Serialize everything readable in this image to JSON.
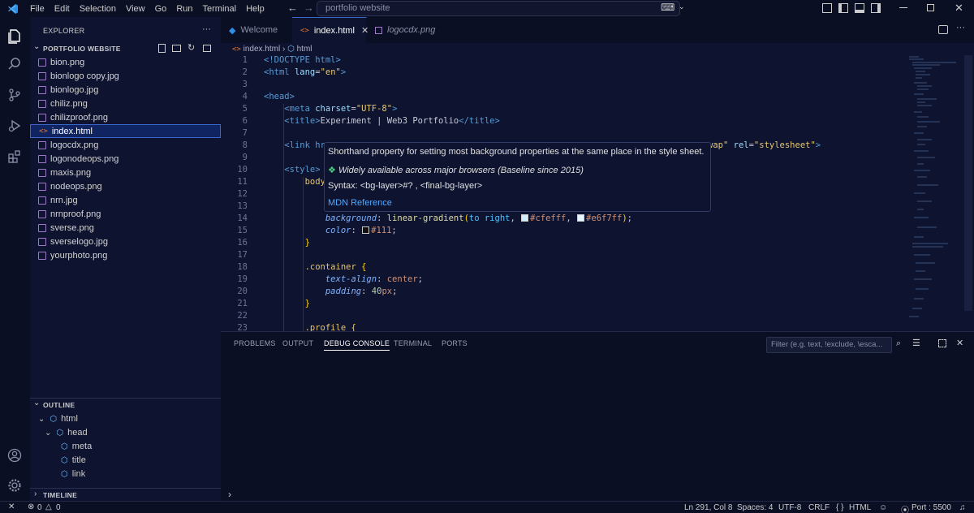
{
  "menu": [
    "File",
    "Edit",
    "Selection",
    "View",
    "Go",
    "Run",
    "Terminal",
    "Help"
  ],
  "search": {
    "placeholder": "portfolio website"
  },
  "sidebar": {
    "title": "EXPLORER",
    "more": "···",
    "folder": "PORTFOLIO WEBSITE",
    "files": [
      "bion.png",
      "bionlogo copy.jpg",
      "bionlogo.jpg",
      "chiliz.png",
      "chilizproof.png",
      "index.html",
      "logocdx.png",
      "logonodeops.png",
      "maxis.png",
      "nodeops.png",
      "nrn.jpg",
      "nrnproof.png",
      "sverse.png",
      "sverselogo.jpg",
      "yourphoto.png"
    ],
    "selected_index": 5,
    "outline": {
      "title": "OUTLINE",
      "items": [
        "html",
        "head",
        "meta",
        "title",
        "link"
      ]
    },
    "timeline": "TIMELINE"
  },
  "tabs": [
    "Welcome",
    "index.html",
    "logocdx.png"
  ],
  "active_tab": 1,
  "breadcrumb": [
    "index.html",
    "html"
  ],
  "editor": {
    "line_numbers": [
      "1",
      "2",
      "3",
      "4",
      "5",
      "6",
      "7",
      "8",
      "9",
      "10",
      "11",
      "12",
      "13",
      "14",
      "15",
      "16",
      "17",
      "18",
      "19",
      "20",
      "21",
      "22",
      "23"
    ],
    "visible_code": {
      "l1": "<!DOCTYPE html>",
      "l2_tag": "<html",
      "l2_attr": "lang",
      "l2_val": "\"en\"",
      "l4": "<head>",
      "l5_attr": "charset",
      "l5_val": "\"UTF-8\"",
      "l6_text": "Experiment | Web3 Portfolio",
      "l8_start": "<link hr",
      "l8_end_val": "wap\"",
      "l8_rel": "rel",
      "l8_rel_val": "\"stylesheet\"",
      "l10": "<style>",
      "l11": "body",
      "l14_prop": "background",
      "l14_fn": "linear-gradient",
      "l14_dir": "to right",
      "l14_c1": "#cfefff",
      "l14_c2": "#e6f7ff",
      "l15_prop": "color",
      "l15_val": "#111",
      "l18_sel": ".container",
      "l19_prop": "text-align",
      "l19_val": "center",
      "l20_prop": "padding",
      "l20_val": "40",
      "l20_unit": "px",
      "l23_sel": ".profile"
    }
  },
  "hover": {
    "description": "Shorthand property for setting most background properties at the same place in the style sheet.",
    "baseline": "Widely available across major browsers (Baseline since 2015)",
    "syntax": "Syntax: <bg-layer>#? , <final-bg-layer>",
    "link": "MDN Reference"
  },
  "panel": {
    "tabs": [
      "PROBLEMS",
      "OUTPUT",
      "DEBUG CONSOLE",
      "TERMINAL",
      "PORTS"
    ],
    "active_tab": 2,
    "filter_placeholder": "Filter (e.g. text, !exclude, \\esca..."
  },
  "status": {
    "errors": "0",
    "warnings": "0",
    "position": "Ln 291, Col 8",
    "spaces": "Spaces: 4",
    "encoding": "UTF-8",
    "eol": "CRLF",
    "language": "HTML",
    "port": "Port : 5500"
  },
  "colors": {
    "accent": "#3c66c9",
    "background": "#0e1330",
    "swatch1": "#cfefff",
    "swatch2": "#e6f7ff",
    "swatch3": "#111111"
  }
}
